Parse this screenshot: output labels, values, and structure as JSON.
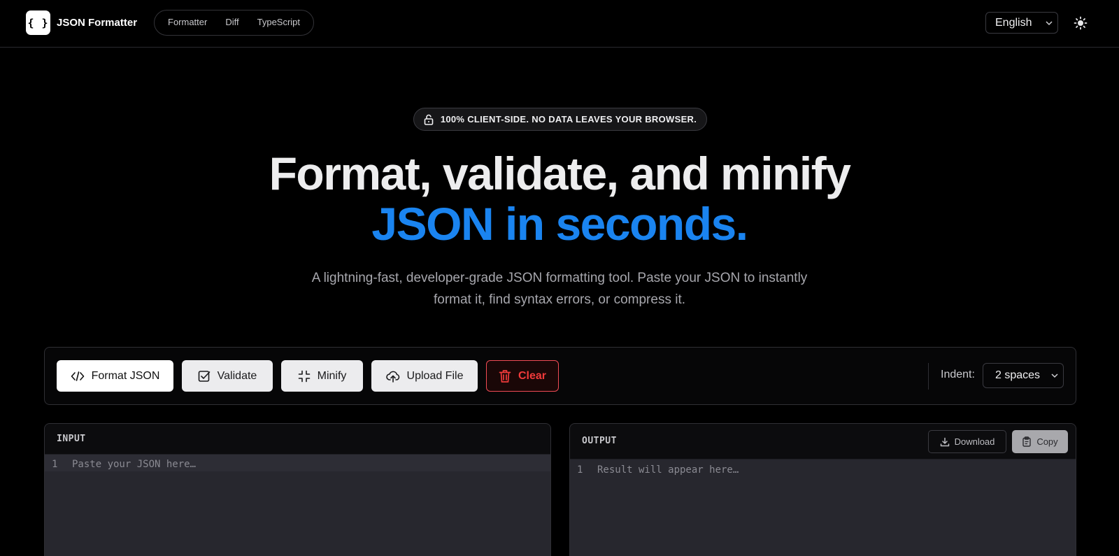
{
  "header": {
    "logo_glyph": "{ }",
    "app_name": "JSON Formatter",
    "nav": [
      {
        "label": "Formatter"
      },
      {
        "label": "Diff"
      },
      {
        "label": "TypeScript"
      }
    ],
    "language": "English",
    "theme_icon": "sun-icon"
  },
  "hero": {
    "badge_icon": "lock-icon",
    "badge_text": "100% CLIENT-SIDE. NO DATA LEAVES YOUR BROWSER.",
    "title_line1": "Format, validate, and minify",
    "title_line2": "JSON in seconds.",
    "subtitle": "A lightning-fast, developer-grade JSON formatting tool. Paste your JSON to instantly format it, find syntax errors, or compress it."
  },
  "toolbar": {
    "format_label": "Format JSON",
    "validate_label": "Validate",
    "minify_label": "Minify",
    "upload_label": "Upload File",
    "clear_label": "Clear",
    "indent_label": "Indent:",
    "indent_value": "2 spaces"
  },
  "input_panel": {
    "title": "INPUT",
    "line_number": "1",
    "placeholder": "Paste your JSON here…"
  },
  "output_panel": {
    "title": "OUTPUT",
    "download_label": "Download",
    "copy_label": "Copy",
    "line_number": "1",
    "placeholder": "Result will appear here…"
  },
  "colors": {
    "accent": "#1a84f0",
    "danger": "#f03a3a",
    "background": "#000000"
  }
}
